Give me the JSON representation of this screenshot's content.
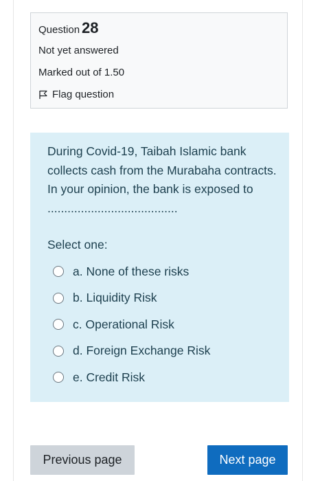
{
  "info": {
    "question_label": "Question",
    "question_number": "28",
    "state": "Not yet answered",
    "grade": "Marked out of 1.50",
    "flag_label": "Flag question"
  },
  "question": {
    "text": "During Covid-19, Taibah Islamic bank collects cash from the Murabaha contracts. In your opinion, the bank is exposed to .......................................",
    "prompt": "Select one:",
    "options": [
      {
        "label": "a. None of these risks"
      },
      {
        "label": "b. Liquidity Risk"
      },
      {
        "label": "c. Operational Risk"
      },
      {
        "label": "d. Foreign Exchange Risk"
      },
      {
        "label": "e. Credit Risk"
      }
    ]
  },
  "navigation": {
    "previous_label": "Previous page",
    "next_label": "Next page"
  },
  "colors": {
    "info_bg": "#f8f9fa",
    "question_bg": "#dbeff7",
    "next_button": "#0f6cbf",
    "previous_button": "#ced4da"
  },
  "icons": {
    "flag": "flag-outline-icon",
    "radio": "radio-unchecked"
  }
}
